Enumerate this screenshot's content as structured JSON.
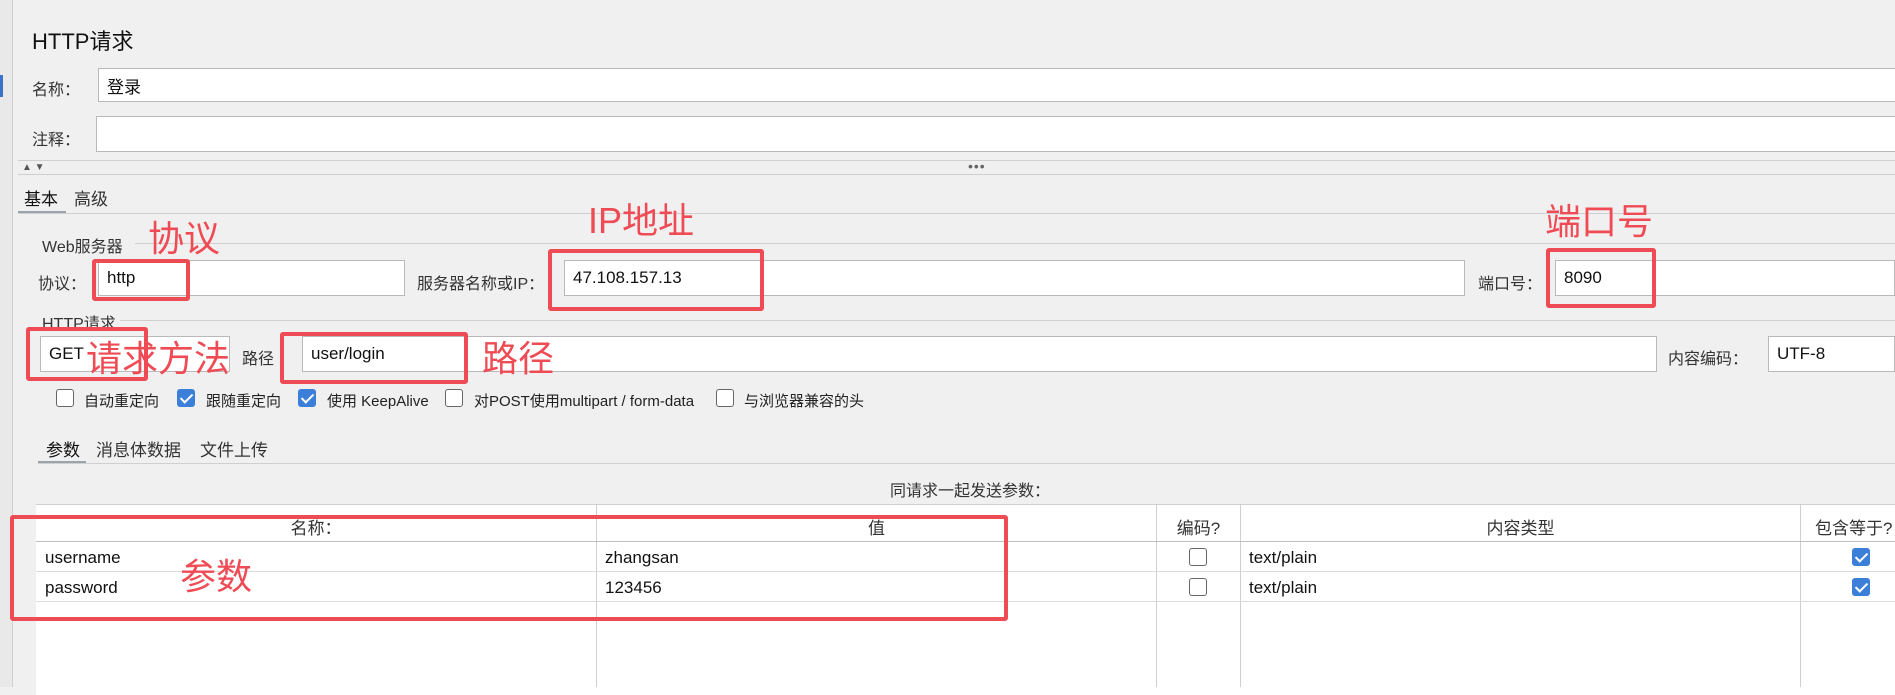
{
  "panel": {
    "title": "HTTP请求"
  },
  "name_field": {
    "label": "名称：",
    "value": "登录"
  },
  "comment_field": {
    "label": "注释：",
    "value": ""
  },
  "splitter": {
    "arrows": "▲ ▼",
    "dots": "•••"
  },
  "main_tabs": [
    {
      "label": "基本"
    },
    {
      "label": "高级"
    }
  ],
  "web_server": {
    "group_label": "Web服务器",
    "protocol_label": "协议：",
    "protocol_value": "http",
    "server_label": "服务器名称或IP：",
    "server_value": "47.108.157.13",
    "port_label": "端口号：",
    "port_value": "8090"
  },
  "http_request": {
    "group_label": "HTTP请求",
    "method_value": "GET",
    "path_label": "路径",
    "path_value": "user/login",
    "encoding_label": "内容编码：",
    "encoding_value": "UTF-8"
  },
  "options": [
    {
      "label": "自动重定向",
      "checked": false
    },
    {
      "label": "跟随重定向",
      "checked": true
    },
    {
      "label": "使用 KeepAlive",
      "checked": true
    },
    {
      "label": "对POST使用multipart / form-data",
      "checked": false
    },
    {
      "label": "与浏览器兼容的头",
      "checked": false
    }
  ],
  "sub_tabs": [
    {
      "label": "参数"
    },
    {
      "label": "消息体数据"
    },
    {
      "label": "文件上传"
    }
  ],
  "params_caption": "同请求一起发送参数：",
  "table": {
    "headers": [
      "名称：",
      "值",
      "编码?",
      "内容类型",
      "包含等于?"
    ],
    "rows": [
      {
        "name": "username",
        "value": "zhangsan",
        "encode": false,
        "content_type": "text/plain",
        "include_equals": true
      },
      {
        "name": "password",
        "value": "123456",
        "encode": false,
        "content_type": "text/plain",
        "include_equals": true
      }
    ]
  },
  "annotations": {
    "protocol": "协议",
    "ip": "IP地址",
    "port": "端口号",
    "method": "请求方法",
    "path": "路径",
    "params": "参数"
  },
  "colors": {
    "annotation": "#ef4b55",
    "checkbox": "#3b7fd9",
    "background": "#f0f0f0"
  }
}
